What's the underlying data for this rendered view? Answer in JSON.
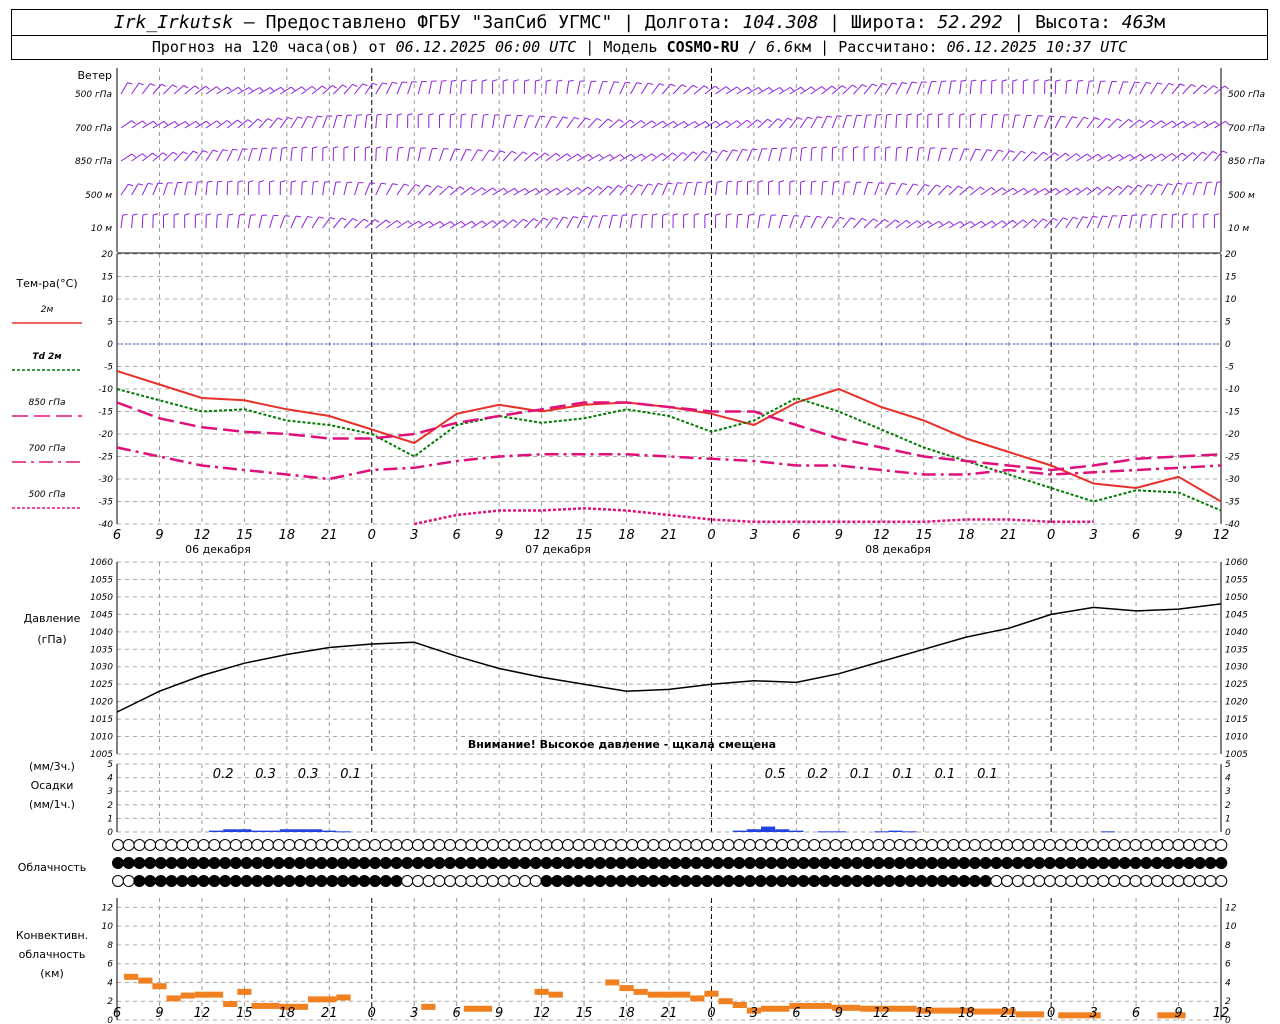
{
  "header": {
    "station": "Irk_Irkutsk",
    "provider": "Предоставлено ФГБУ \"ЗапСиб УГМС\"",
    "lon_label": "Долгота:",
    "lon": "104.308",
    "lat_label": "Широта:",
    "lat": "52.292",
    "alt_label": "Высота:",
    "alt": "463",
    "alt_unit": "м",
    "forecast_label": "Прогноз на 120 часа(ов) от",
    "forecast_time": "06.12.2025 06:00 UTC",
    "model_label": "Модель",
    "model": "COSMO-RU",
    "res": "6.6",
    "res_unit": "км",
    "calc_label": "Рассчитано:",
    "calc_time": "06.12.2025 10:37 UTC"
  },
  "x_ticks": [
    "6",
    "9",
    "12",
    "15",
    "18",
    "21",
    "0",
    "3",
    "6",
    "9",
    "12",
    "15",
    "18",
    "21",
    "0",
    "3",
    "6",
    "9",
    "12",
    "15",
    "18",
    "21",
    "0",
    "3",
    "6",
    "9",
    "12"
  ],
  "days": [
    "06 декабря",
    "07 декабря",
    "08 декабря"
  ],
  "wind": {
    "title": "Ветер",
    "levels": [
      "500 гПа",
      "700 гПа",
      "850 гПа",
      "500 м",
      "10 м"
    ]
  },
  "colors": {
    "t2m": "#e8302a",
    "td2m": "#007a00",
    "t850": "#e0107a",
    "t700": "#e0107a",
    "t500": "#e0107a",
    "wind": "#9020e0",
    "pressure": "#000000",
    "precip": "#2040e0",
    "conv": "#f08020"
  },
  "chart_data": [
    {
      "type": "line",
      "ylabel": "Тем-ра(°С)",
      "ylim": [
        -40,
        20
      ],
      "y_ticks": [
        20,
        15,
        10,
        5,
        0,
        -5,
        -10,
        -15,
        -20,
        -25,
        -30,
        -35,
        -40
      ],
      "x": [
        0,
        3,
        6,
        9,
        12,
        15,
        18,
        21,
        24,
        27,
        30,
        33,
        36,
        39,
        42,
        45,
        48,
        51,
        54,
        57,
        60,
        63,
        66,
        69,
        72,
        75,
        78
      ],
      "series": [
        {
          "name": "2м",
          "values": [
            -6,
            -9,
            -12,
            -12.5,
            -14.5,
            -16,
            -19,
            -22,
            -15.5,
            -13.5,
            -15,
            -13.5,
            -13,
            -14,
            -15.5,
            -18,
            -13,
            -10,
            -14,
            -17,
            -21,
            -24,
            -27,
            -31,
            -32,
            -29.5,
            -35
          ]
        },
        {
          "name": "Td 2м",
          "values": [
            -10,
            -12.5,
            -15,
            -14.5,
            -17,
            -18,
            -20,
            -25,
            -18,
            -16,
            -17.5,
            -16.5,
            -14.5,
            -16,
            -19.5,
            -17,
            -12,
            -15,
            -19,
            -23,
            -26,
            -29,
            -32,
            -35,
            -32.5,
            -33,
            -37
          ]
        },
        {
          "name": "850 гПа",
          "values": [
            -13,
            -16.5,
            -18.5,
            -19.5,
            -20,
            -21,
            -21,
            -20,
            -17.5,
            -16,
            -14.5,
            -13,
            -13,
            -14,
            -15,
            -15,
            -18,
            -21,
            -23,
            -25,
            -26,
            -27,
            -28,
            -27,
            -25.5,
            -25,
            -24.5
          ]
        },
        {
          "name": "700 гПа",
          "values": [
            -23,
            -25,
            -27,
            -28,
            -29,
            -30,
            -28,
            -27.5,
            -26,
            -25,
            -24.5,
            -24.5,
            -24.5,
            -25,
            -25.5,
            -26,
            -27,
            -27,
            -28,
            -29,
            -29,
            -28,
            -29,
            -28.5,
            -28,
            -27.5,
            -27
          ]
        },
        {
          "name": "500 гПа",
          "values": [
            null,
            null,
            null,
            null,
            null,
            null,
            null,
            -40,
            -38,
            -37,
            -37,
            -36.5,
            -37,
            -38,
            -39,
            -39.5,
            -39.5,
            -39.5,
            -39.5,
            -39.5,
            -39,
            -39,
            -39.5,
            -39.5,
            null,
            null,
            null
          ]
        }
      ]
    },
    {
      "type": "line",
      "ylabel": "Давление",
      "yunit": "(гПа)",
      "ylim": [
        1005,
        1060
      ],
      "y_ticks": [
        1060,
        1055,
        1050,
        1045,
        1040,
        1035,
        1030,
        1025,
        1020,
        1015,
        1010,
        1005
      ],
      "note": "Внимание! Высокое давление - щкала смещена",
      "x": [
        0,
        3,
        6,
        9,
        12,
        15,
        18,
        21,
        24,
        27,
        30,
        33,
        36,
        39,
        42,
        45,
        48,
        51,
        54,
        57,
        60,
        63,
        66,
        69,
        72,
        75,
        78
      ],
      "values": [
        1017,
        1023,
        1027.5,
        1031,
        1033.5,
        1035.5,
        1036.5,
        1037,
        1033,
        1029.5,
        1027,
        1025,
        1023,
        1023.5,
        1025,
        1026,
        1025.5,
        1028,
        1031.5,
        1035,
        1038.5,
        1041,
        1045,
        1047,
        1046,
        1046.5,
        1048
      ]
    },
    {
      "type": "bar",
      "ylabel": "Осадки",
      "yunit_top": "(мм/3ч.)",
      "yunit_bottom": "(мм/1ч.)",
      "ylim": [
        0,
        5
      ],
      "y_ticks": [
        5,
        4,
        3,
        2,
        1,
        0
      ],
      "sums": [
        {
          "x": 7.5,
          "label": "0.2"
        },
        {
          "x": 10.5,
          "label": "0.3"
        },
        {
          "x": 13.5,
          "label": "0.3"
        },
        {
          "x": 16.5,
          "label": "0.1"
        },
        {
          "x": 46.5,
          "label": "0.5"
        },
        {
          "x": 49.5,
          "label": "0.2"
        },
        {
          "x": 52.5,
          "label": "0.1"
        },
        {
          "x": 55.5,
          "label": "0.1"
        },
        {
          "x": 58.5,
          "label": "0.1"
        },
        {
          "x": 61.5,
          "label": "0.1"
        }
      ],
      "bars": [
        [
          7,
          0.1
        ],
        [
          8,
          0.2
        ],
        [
          9,
          0.2
        ],
        [
          10,
          0.1
        ],
        [
          11,
          0.1
        ],
        [
          12,
          0.2
        ],
        [
          13,
          0.2
        ],
        [
          14,
          0.2
        ],
        [
          15,
          0.1
        ],
        [
          16,
          0.05
        ],
        [
          44,
          0.1
        ],
        [
          45,
          0.2
        ],
        [
          46,
          0.4
        ],
        [
          47,
          0.2
        ],
        [
          48,
          0.1
        ],
        [
          50,
          0.05
        ],
        [
          51,
          0.05
        ],
        [
          54,
          0.05
        ],
        [
          55,
          0.1
        ],
        [
          56,
          0.05
        ],
        [
          70,
          0.05
        ]
      ]
    },
    {
      "type": "bar",
      "ylabel": "Конвективн. облачность",
      "yunit": "(км)",
      "ylim": [
        0,
        13
      ],
      "y_ticks": [
        12,
        10,
        8,
        6,
        4,
        2,
        0
      ],
      "segments": [
        [
          0.5,
          1.5,
          4.6
        ],
        [
          1.5,
          2.5,
          4.2
        ],
        [
          2.5,
          3.5,
          3.6
        ],
        [
          3.5,
          4.5,
          2.3
        ],
        [
          4.5,
          5.5,
          2.6
        ],
        [
          5.5,
          7.5,
          2.7
        ],
        [
          7.5,
          8.5,
          1.7
        ],
        [
          8.5,
          9.5,
          3.0
        ],
        [
          9.5,
          11.5,
          1.5
        ],
        [
          11.5,
          13.5,
          1.4
        ],
        [
          13.5,
          15.5,
          2.2
        ],
        [
          15.5,
          16.5,
          2.4
        ],
        [
          21.5,
          22.5,
          1.4
        ],
        [
          24.5,
          26.5,
          1.2
        ],
        [
          29.5,
          30.5,
          3.0
        ],
        [
          30.5,
          31.5,
          2.7
        ],
        [
          34.5,
          35.5,
          4.0
        ],
        [
          35.5,
          36.5,
          3.4
        ],
        [
          36.5,
          37.5,
          3.0
        ],
        [
          37.5,
          40.5,
          2.7
        ],
        [
          40.5,
          41.5,
          2.3
        ],
        [
          41.5,
          42.5,
          2.8
        ],
        [
          42.5,
          43.5,
          2.0
        ],
        [
          43.5,
          44.5,
          1.6
        ],
        [
          44.5,
          45.5,
          1.0
        ],
        [
          45.5,
          47.5,
          1.2
        ],
        [
          47.5,
          50.5,
          1.5
        ],
        [
          50.5,
          52.5,
          1.3
        ],
        [
          52.5,
          56.5,
          1.2
        ],
        [
          56.5,
          60.5,
          1.0
        ],
        [
          60.5,
          63.5,
          0.9
        ],
        [
          63.5,
          65.5,
          0.6
        ],
        [
          66.5,
          69.5,
          0.5
        ],
        [
          73.5,
          75.5,
          0.5
        ]
      ]
    }
  ],
  "clouds": {
    "title": "Облачность",
    "rows": [
      "00000000000000000000000000000000000000000000000000000000000000000000000000000000000000000000000000000000",
      "44444444444444444444444444444444444444444444444444444444444444444444444444444444444444444444444444444444",
      "00444444444444444444444444400000000000004444444444444444444444444444444444444444440000000000000000000000"
    ]
  }
}
